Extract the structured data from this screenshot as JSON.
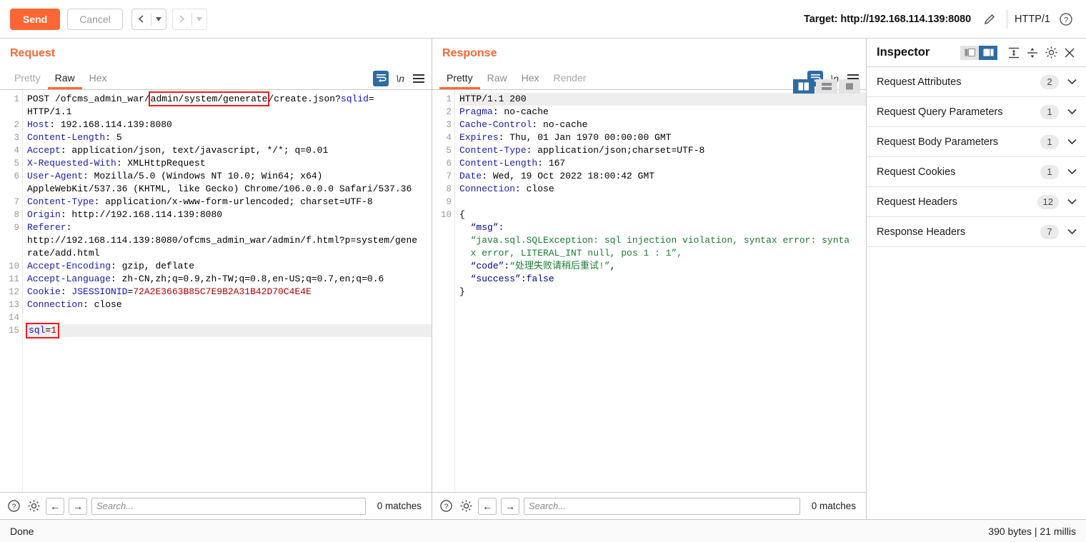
{
  "topbar": {
    "send_label": "Send",
    "cancel_label": "Cancel",
    "prev_glyph": "‹",
    "next_glyph": "›",
    "dropdown_glyph": "▼",
    "target_label": "Target: http://192.168.114.139:8080",
    "edit_icon": "pencil-icon",
    "http_version": "HTTP/1",
    "help_icon": "question-circle-icon"
  },
  "request": {
    "title": "Request",
    "tabs": [
      {
        "label": "Pretty",
        "active": false,
        "dim": true
      },
      {
        "label": "Raw",
        "active": true,
        "dim": false
      },
      {
        "label": "Hex",
        "active": false,
        "dim": false
      }
    ],
    "wrap_icon": "word-wrap-icon",
    "newline_icon": "\\n",
    "menu_icon": "hamburger-menu-icon",
    "line_numbers": [
      "1",
      "",
      "2",
      "3",
      "4",
      "5",
      "6",
      "",
      "7",
      "8",
      "9",
      "",
      "",
      "10",
      "11",
      "12",
      "13",
      "14",
      "15"
    ],
    "lines": [
      {
        "n": 1,
        "segments": [
          {
            "t": "POST /ofcms_admin_war/",
            "c": "plain"
          },
          {
            "t": "admin/system/generate",
            "c": "boxed"
          },
          {
            "t": "/create.json?",
            "c": "plain"
          },
          {
            "t": "sqlid",
            "c": "blue"
          },
          {
            "t": "=",
            "c": "plain"
          }
        ]
      },
      {
        "n": "",
        "segments": [
          {
            "t": "HTTP/1.1",
            "c": "plain"
          }
        ]
      },
      {
        "n": 2,
        "segments": [
          {
            "t": "Host",
            "c": "hdr"
          },
          {
            "t": ": 192.168.114.139:8080",
            "c": "plain"
          }
        ]
      },
      {
        "n": 3,
        "segments": [
          {
            "t": "Content-Length",
            "c": "hdr"
          },
          {
            "t": ": 5",
            "c": "plain"
          }
        ]
      },
      {
        "n": 4,
        "segments": [
          {
            "t": "Accept",
            "c": "hdr"
          },
          {
            "t": ": application/json, text/javascript, */*; q=0.01",
            "c": "plain"
          }
        ]
      },
      {
        "n": 5,
        "segments": [
          {
            "t": "X-Requested-With",
            "c": "hdr"
          },
          {
            "t": ": XMLHttpRequest",
            "c": "plain"
          }
        ]
      },
      {
        "n": 6,
        "segments": [
          {
            "t": "User-Agent",
            "c": "hdr"
          },
          {
            "t": ": Mozilla/5.0 (Windows NT 10.0; Win64; x64)",
            "c": "plain"
          }
        ]
      },
      {
        "n": "",
        "segments": [
          {
            "t": "AppleWebKit/537.36 (KHTML, like Gecko) Chrome/106.0.0.0 Safari/537.36",
            "c": "plain"
          }
        ]
      },
      {
        "n": 7,
        "segments": [
          {
            "t": "Content-Type",
            "c": "hdr"
          },
          {
            "t": ": application/x-www-form-urlencoded; charset=UTF-8",
            "c": "plain"
          }
        ]
      },
      {
        "n": 8,
        "segments": [
          {
            "t": "Origin",
            "c": "hdr"
          },
          {
            "t": ": http://192.168.114.139:8080",
            "c": "plain"
          }
        ]
      },
      {
        "n": 9,
        "segments": [
          {
            "t": "Referer",
            "c": "hdr"
          },
          {
            "t": ":",
            "c": "plain"
          }
        ]
      },
      {
        "n": "",
        "segments": [
          {
            "t": "http://192.168.114.139:8080/ofcms_admin_war/admin/f.html?p=system/gene",
            "c": "plain"
          }
        ]
      },
      {
        "n": "",
        "segments": [
          {
            "t": "rate/add.html",
            "c": "plain"
          }
        ]
      },
      {
        "n": 10,
        "segments": [
          {
            "t": "Accept-Encoding",
            "c": "hdr"
          },
          {
            "t": ": gzip, deflate",
            "c": "plain"
          }
        ]
      },
      {
        "n": 11,
        "segments": [
          {
            "t": "Accept-Language",
            "c": "hdr"
          },
          {
            "t": ": zh-CN,zh;q=0.9,zh-TW;q=0.8,en-US;q=0.7,en;q=0.6",
            "c": "plain"
          }
        ]
      },
      {
        "n": 12,
        "segments": [
          {
            "t": "Cookie",
            "c": "hdr"
          },
          {
            "t": ": ",
            "c": "plain"
          },
          {
            "t": "JSESSIONID",
            "c": "blue"
          },
          {
            "t": "=",
            "c": "plain"
          },
          {
            "t": "72A2E3663B85C7E9B2A31B42D70C4E4E",
            "c": "red"
          }
        ]
      },
      {
        "n": 13,
        "segments": [
          {
            "t": "Connection",
            "c": "hdr"
          },
          {
            "t": ": close",
            "c": "plain"
          }
        ]
      },
      {
        "n": 14,
        "segments": [
          {
            "t": "",
            "c": "plain"
          }
        ]
      },
      {
        "n": 15,
        "highlight": true,
        "segments": [
          {
            "t": "sql",
            "c": "body-blue"
          },
          {
            "t": "=",
            "c": "body-plain"
          },
          {
            "t": "1",
            "c": "body-red"
          }
        ],
        "boxed_body": true
      }
    ],
    "search": {
      "placeholder": "Search...",
      "value": "",
      "matches": "0 matches",
      "help_icon": "question-circle-icon",
      "settings_icon": "gear-icon",
      "prev_icon": "←",
      "next_icon": "→"
    }
  },
  "response": {
    "title": "Response",
    "tabs": [
      {
        "label": "Pretty",
        "active": true,
        "dim": false
      },
      {
        "label": "Raw",
        "active": false,
        "dim": false
      },
      {
        "label": "Hex",
        "active": false,
        "dim": false
      },
      {
        "label": "Render",
        "active": false,
        "dim": true
      }
    ],
    "wrap_icon": "word-wrap-icon",
    "newline_icon": "\\n",
    "menu_icon": "hamburger-menu-icon",
    "layout_toggles": [
      {
        "name": "side-by-side-layout-icon",
        "active": true
      },
      {
        "name": "stacked-layout-icon",
        "active": false
      },
      {
        "name": "single-pane-layout-icon",
        "active": false
      }
    ],
    "lines": [
      {
        "n": 1,
        "highlight": true,
        "segments": [
          {
            "t": "HTTP/1.1 200",
            "c": "plain"
          }
        ]
      },
      {
        "n": 2,
        "segments": [
          {
            "t": "Pragma",
            "c": "hdr"
          },
          {
            "t": ": no-cache",
            "c": "plain"
          }
        ]
      },
      {
        "n": 3,
        "segments": [
          {
            "t": "Cache-Control",
            "c": "hdr"
          },
          {
            "t": ": no-cache",
            "c": "plain"
          }
        ]
      },
      {
        "n": 4,
        "segments": [
          {
            "t": "Expires",
            "c": "hdr"
          },
          {
            "t": ": Thu, 01 Jan 1970 00:00:00 GMT",
            "c": "plain"
          }
        ]
      },
      {
        "n": 5,
        "segments": [
          {
            "t": "Content-Type",
            "c": "hdr"
          },
          {
            "t": ": application/json;charset=UTF-8",
            "c": "plain"
          }
        ]
      },
      {
        "n": 6,
        "segments": [
          {
            "t": "Content-Length",
            "c": "hdr"
          },
          {
            "t": ": 167",
            "c": "plain"
          }
        ]
      },
      {
        "n": 7,
        "segments": [
          {
            "t": "Date",
            "c": "hdr"
          },
          {
            "t": ": Wed, 19 Oct 2022 18:00:42 GMT",
            "c": "plain"
          }
        ]
      },
      {
        "n": 8,
        "segments": [
          {
            "t": "Connection",
            "c": "hdr"
          },
          {
            "t": ": close",
            "c": "plain"
          }
        ]
      },
      {
        "n": 9,
        "segments": [
          {
            "t": "",
            "c": "plain"
          }
        ]
      },
      {
        "n": 10,
        "segments": [
          {
            "t": "{",
            "c": "plain"
          }
        ]
      },
      {
        "n": "",
        "segments": [
          {
            "t": "  “msg”:",
            "c": "navy"
          }
        ]
      },
      {
        "n": "",
        "segments": [
          {
            "t": "  “java.sql.SQLException: sql injection violation, syntax error: synta",
            "c": "green"
          }
        ]
      },
      {
        "n": "",
        "segments": [
          {
            "t": "  x error, LITERAL_INT null, pos 1 : 1”,",
            "c": "green"
          }
        ]
      },
      {
        "n": "",
        "segments": [
          {
            "t": "  “code”",
            "c": "navy"
          },
          {
            "t": ":",
            "c": "plain"
          },
          {
            "t": "“处理失败请稍后重试!”",
            "c": "green"
          },
          {
            "t": ",",
            "c": "plain"
          }
        ]
      },
      {
        "n": "",
        "segments": [
          {
            "t": "  “success”",
            "c": "navy"
          },
          {
            "t": ":",
            "c": "plain"
          },
          {
            "t": "false",
            "c": "navy"
          }
        ]
      },
      {
        "n": "",
        "segments": [
          {
            "t": "}",
            "c": "plain"
          }
        ]
      }
    ],
    "search": {
      "placeholder": "Search...",
      "value": "",
      "matches": "0 matches",
      "help_icon": "question-circle-icon",
      "settings_icon": "gear-icon",
      "prev_icon": "←",
      "next_icon": "→"
    }
  },
  "inspector": {
    "title": "Inspector",
    "toggles": [
      {
        "name": "inspector-collapse-icon",
        "active": false
      },
      {
        "name": "inspector-expand-icon",
        "active": true
      }
    ],
    "expand_all_icon": "expand-all-icon",
    "collapse_all_icon": "collapse-all-icon",
    "settings_icon": "gear-icon",
    "close_icon": "close-icon",
    "sections": [
      {
        "label": "Request Attributes",
        "count": "2"
      },
      {
        "label": "Request Query Parameters",
        "count": "1"
      },
      {
        "label": "Request Body Parameters",
        "count": "1"
      },
      {
        "label": "Request Cookies",
        "count": "1"
      },
      {
        "label": "Request Headers",
        "count": "12"
      },
      {
        "label": "Response Headers",
        "count": "7"
      }
    ],
    "chevron_glyph": "⌄"
  },
  "statusbar": {
    "left": "Done",
    "right": "390 bytes | 21 millis"
  }
}
